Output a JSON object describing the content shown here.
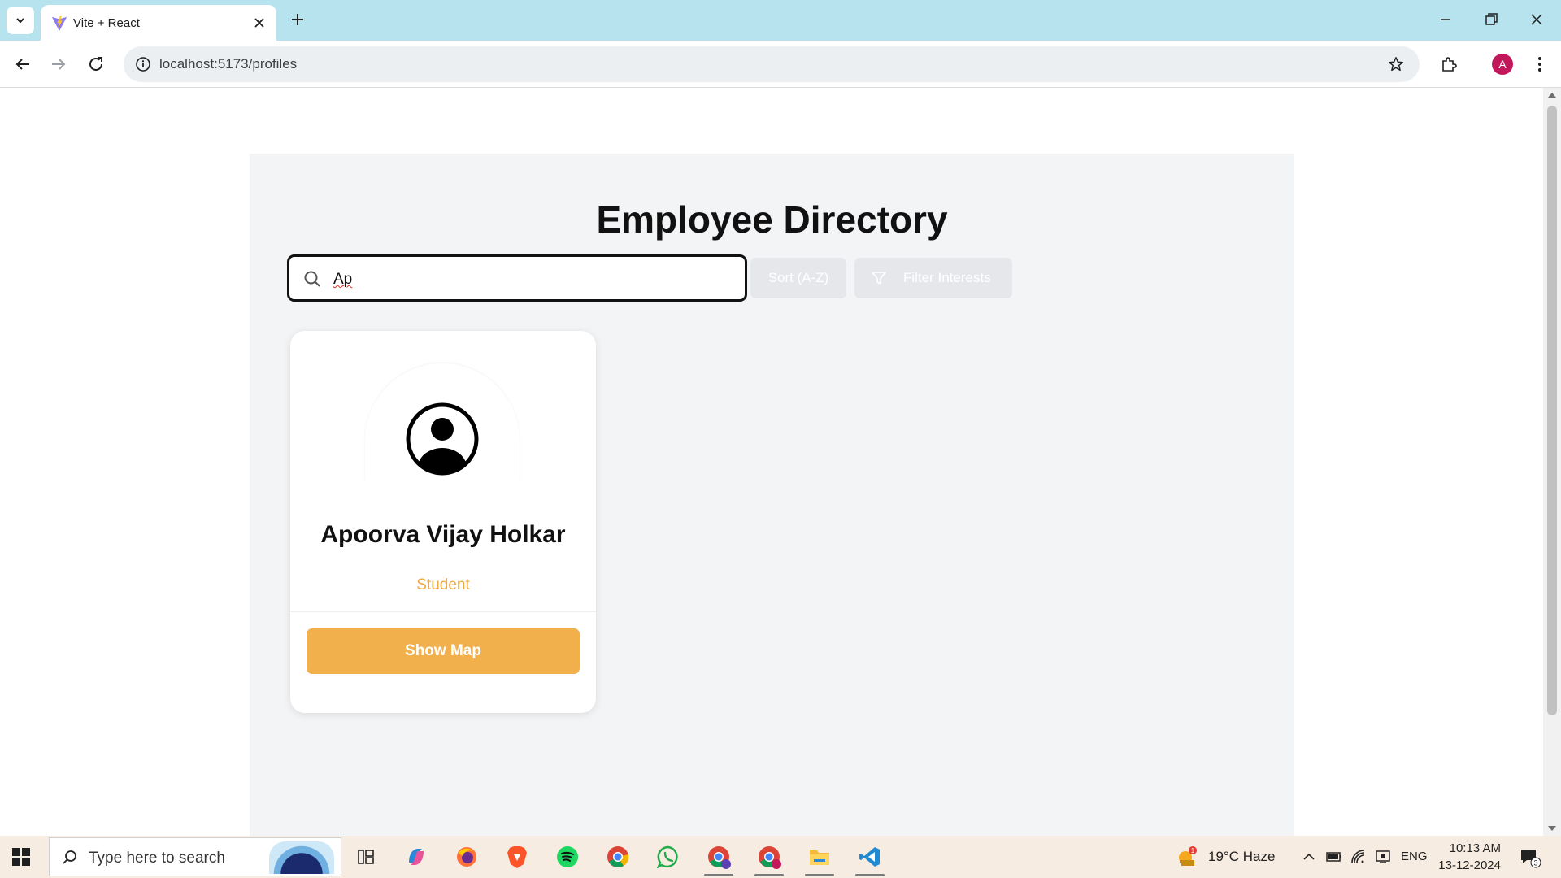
{
  "browser": {
    "tab_title": "Vite + React",
    "url": "localhost:5173/profiles",
    "profile_initial": "A"
  },
  "page": {
    "title": "Employee Directory",
    "search": {
      "value": "Ap",
      "placeholder": ""
    },
    "sort_button": "Sort (A-Z)",
    "filter_button": "Filter Interests"
  },
  "profiles": [
    {
      "name": "Apoorva Vijay Holkar",
      "role": "Student",
      "action": "Show Map"
    }
  ],
  "colors": {
    "accent": "#f2b04c",
    "role_text": "#f0a840",
    "panel_bg": "#f3f4f6",
    "tabbar_bg": "#b6e3ee"
  },
  "taskbar": {
    "search_placeholder": "Type here to search",
    "weather": "19°C  Haze",
    "language": "ENG",
    "time": "10:13 AM",
    "date": "13-12-2024",
    "notification_count": "3",
    "weather_alert": "1"
  }
}
